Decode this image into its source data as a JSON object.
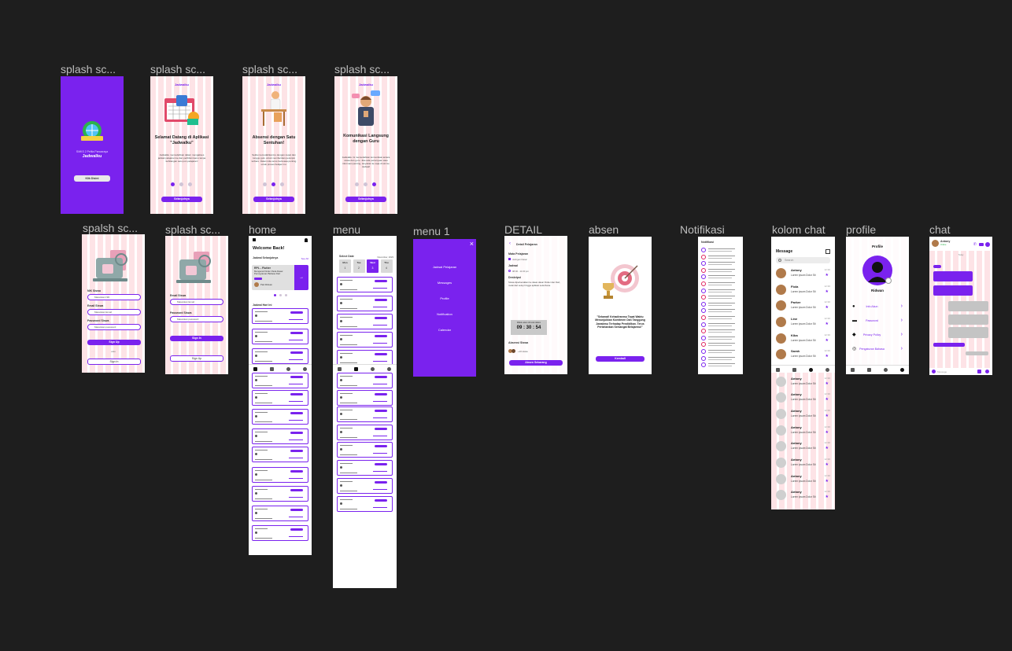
{
  "labels": {
    "splash1": "splash sc...",
    "splash2": "splash sc...",
    "splash3": "splash sc...",
    "splash4": "splash sc...",
    "splash5": "spalsh sc...",
    "splash6": "splash sc...",
    "home": "home",
    "menu": "menu",
    "menu1": "menu 1",
    "detail": "DETAIL",
    "absen": "absen",
    "notifikasi": "Notifikasi",
    "kolom_chat": "kolom chat",
    "profile": "profile",
    "chat": "chat"
  },
  "splash_logo": {
    "school": "SMKS 2 Pelita Pancaraya",
    "app": "Jadwalku",
    "button": "Klik Disini"
  },
  "brand": "Jadwalku",
  "onboarding": [
    {
      "title": "Selamat Datang di Aplikasi \"Jadwalku\"",
      "desc": "Jadwalku memudahkan dalam mengakses jadwal pelajaran ke dan pertbilan kamu tanpa kehilangan satu pun pelajaran!",
      "button": "Selanjutnya"
    },
    {
      "title": "Absensi dengan Satu Sentuhan!",
      "desc": "Sekla memudahkanmu dengan cepat dan tunggu guru untuk memberikan petunjuk terbaru. Dalam kita terus berkuasa penting untuk proses belajar mu.",
      "button": "Selanjutnya"
    },
    {
      "title": "Komunikasi Langsung dengan Guru",
      "desc": "Jadwalku ini memudahkan komunikasi antara siswa dan guru. Jika ada pertanyaan atau informasi penting, tanyakan ke saja di sini ke Jadwal!",
      "button": "Selanjutnya"
    }
  ],
  "signup": {
    "nik_label": "NIK Siswa",
    "nik_placeholder": "Masukkan NIK",
    "email_label": "Email Siswa",
    "email_placeholder": "Masukkan Email",
    "pass_label": "Password Siswa",
    "pass_placeholder": "Masukkan password",
    "signup_btn": "Sign Up",
    "or": "atau",
    "signin_btn": "Sign In"
  },
  "signin": {
    "email_label": "Email Siswa",
    "email_placeholder": "Masukkan Email",
    "pass_label": "Password Siswa",
    "pass_placeholder": "Masukkan password",
    "signin_btn": "Sign In",
    "signup_btn": "Sign Up"
  },
  "home": {
    "title": "Welcome Back!",
    "next_label": "Jadwal Selanjutnya",
    "see_all": "See All",
    "card_title": "RPL - Flutter",
    "card_sub": "Mengenal Flutter Pada Dasar Pemograman Bahasa Dart",
    "teacher": "Pak Ridwan",
    "today_label": "Jadwal Hari Ini"
  },
  "menu": {
    "select": "Select Date",
    "month": "November, 2023",
    "days": [
      {
        "d": "Mon",
        "n": "1"
      },
      {
        "d": "Tue",
        "n": "2"
      },
      {
        "d": "Wed",
        "n": "3"
      },
      {
        "d": "Thu",
        "n": "4"
      }
    ]
  },
  "menu1": {
    "items": [
      "Jadwal Pelajaran",
      "Messages",
      "Profile",
      "Notification",
      "Calendar"
    ],
    "close": "×"
  },
  "detail": {
    "header": "Detail Pelajaran",
    "mapel_label": "Mata Pelajaran",
    "mapel": "Jaringan Dasar",
    "jadwal_label": "Jadwal",
    "jadwal": "08:00 - 11:00 pm",
    "desc_label": "Deskripsi",
    "desc": "Siswa diperkenalkan ke dasar-dasar Flutter dan Dart, mulai dari setup hingga aplikasi sederhana.",
    "timer_label": "Waktu akan dimulai dalam",
    "timer": "09 : 30 : 54",
    "absen_label": "Absensi Siswa",
    "absen_count": "+10 siswa",
    "button": "Absen Sekarang"
  },
  "absen": {
    "quote": "\"Selamat! Kehadiranmu Tepat Waktu Menunjukkan Komitmen Dan Tanggung Jawabmu Terhadap Pendidikan. Terus Pertahankan Semangat Belajarmu!\"",
    "button": "Kembali"
  },
  "notifikasi": {
    "title": "Notifikasi",
    "status": [
      "purple",
      "red",
      "purple",
      "red",
      "purple",
      "red",
      "purple",
      "red",
      "purple",
      "purple",
      "red",
      "purple",
      "red",
      "purple",
      "red",
      "purple",
      "purple",
      "purple"
    ]
  },
  "kolom_chat": {
    "title": "Message",
    "search": "Search",
    "chats": [
      {
        "name": "Antony",
        "msg": "Lorem ipsum Dolor Sit",
        "time": "12:30",
        "photo": true
      },
      {
        "name": "Fiola",
        "msg": "Lorem ipsum Dolor Sit",
        "time": "12:30",
        "photo": true
      },
      {
        "name": "Parker",
        "msg": "Lorem ipsum Dolor Sit",
        "time": "12:30",
        "photo": true
      },
      {
        "name": "Line",
        "msg": "Lorem ipsum Dolor Sit",
        "time": "12:30",
        "photo": true
      },
      {
        "name": "Kiba",
        "msg": "Lorem ipsum Dolor Sit",
        "time": "12:30",
        "photo": true
      },
      {
        "name": "Sarah",
        "msg": "Lorem ipsum Dolor Sit",
        "time": "12:30",
        "photo": true
      },
      {
        "name": "Antony",
        "msg": "Lorem ipsum Dolor Sit",
        "time": "12:30",
        "photo": false
      },
      {
        "name": "Antony",
        "msg": "Lorem ipsum Dolor Sit",
        "time": "12:30",
        "photo": false
      },
      {
        "name": "Antony",
        "msg": "Lorem ipsum Dolor Sit",
        "time": "12:30",
        "photo": false
      },
      {
        "name": "Antony",
        "msg": "Lorem ipsum Dolor Sit",
        "time": "12:30",
        "photo": false
      },
      {
        "name": "Antony",
        "msg": "Lorem ipsum Dolor Sit",
        "time": "12:30",
        "photo": false
      },
      {
        "name": "Antony",
        "msg": "Lorem ipsum Dolor Sit",
        "time": "12:30",
        "photo": false
      },
      {
        "name": "Antony",
        "msg": "Lorem ipsum Dolor Sit",
        "time": "12:30",
        "photo": false
      },
      {
        "name": "Antony",
        "msg": "Lorem ipsum Dolor Sit",
        "time": "12:30",
        "photo": false
      },
      {
        "name": "Antony",
        "msg": "Lorem ipsum Dolor Sit",
        "time": "12:30",
        "photo": false
      }
    ]
  },
  "profile": {
    "title": "Profile",
    "name": "Ridwan",
    "rows": [
      "Info Akun",
      "Password",
      "Privacy Policy",
      "Pengaturan Bahasa"
    ]
  },
  "chat": {
    "name": "Antony",
    "status": "Online",
    "today": "Today",
    "placeholder": "Message"
  },
  "colors": {
    "accent": "#7a22ee",
    "canvas": "#1e1e1e",
    "pink": "#fde3e6"
  }
}
